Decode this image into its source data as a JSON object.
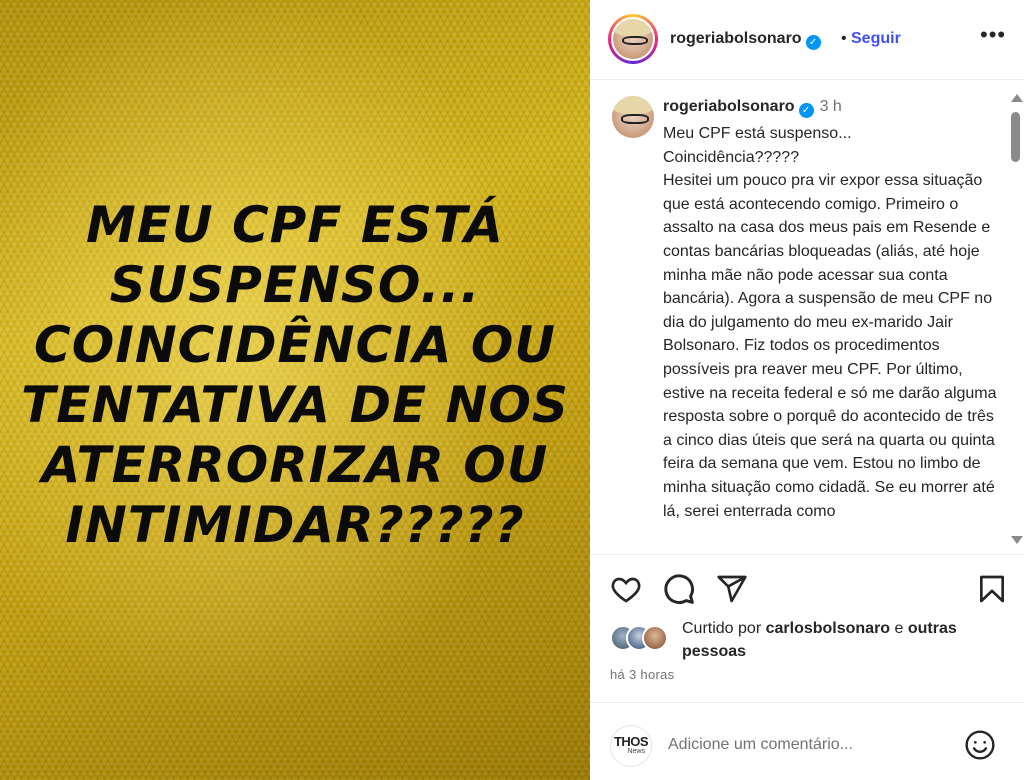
{
  "post_image": {
    "headline_lines": [
      "MEU CPF ESTÁ",
      "SUSPENSO...",
      "COINCIDÊNCIA OU",
      "TENTATIVA DE NOS",
      "ATERRORIZAR OU",
      "INTIMIDAR?????"
    ],
    "background_color": "#c9a514"
  },
  "header": {
    "username": "rogeriabolsonaro",
    "separator": "•",
    "follow_label": "Seguir",
    "more_label": "•••",
    "follow_color": "#4150f7"
  },
  "caption": {
    "username": "rogeriabolsonaro",
    "time": "3 h",
    "text": "Meu CPF está suspenso...\nCoincidência?????\nHesitei um pouco pra vir expor essa situação que está acontecendo comigo. Primeiro o assalto na casa dos meus pais em Resende e contas bancárias bloqueadas (aliás, até hoje minha mãe não pode acessar sua conta bancária). Agora a suspensão de meu CPF no dia do julgamento do meu ex-marido Jair Bolsonaro. Fiz todos os procedimentos possíveis pra reaver meu CPF. Por último, estive na receita federal e só me darão alguma resposta sobre o porquê do acontecido de três a cinco dias úteis que será na quarta ou quinta feira da semana que vem. Estou no limbo de minha situação como cidadã. Se eu morrer até lá, serei enterrada como"
  },
  "likes": {
    "prefix": "Curtido por ",
    "user": "carlosbolsonaro",
    "middle": " e ",
    "others": "outras pessoas"
  },
  "timestamp": "há 3 horas",
  "comment": {
    "avatar_big": "THOS",
    "avatar_small": "News",
    "placeholder": "Adicione um comentário..."
  },
  "icons": {
    "like": "heart-icon",
    "comment": "comment-bubble-icon",
    "share": "paper-plane-icon",
    "save": "bookmark-icon",
    "emoji": "smiley-icon",
    "verified": "verified-badge-icon"
  }
}
